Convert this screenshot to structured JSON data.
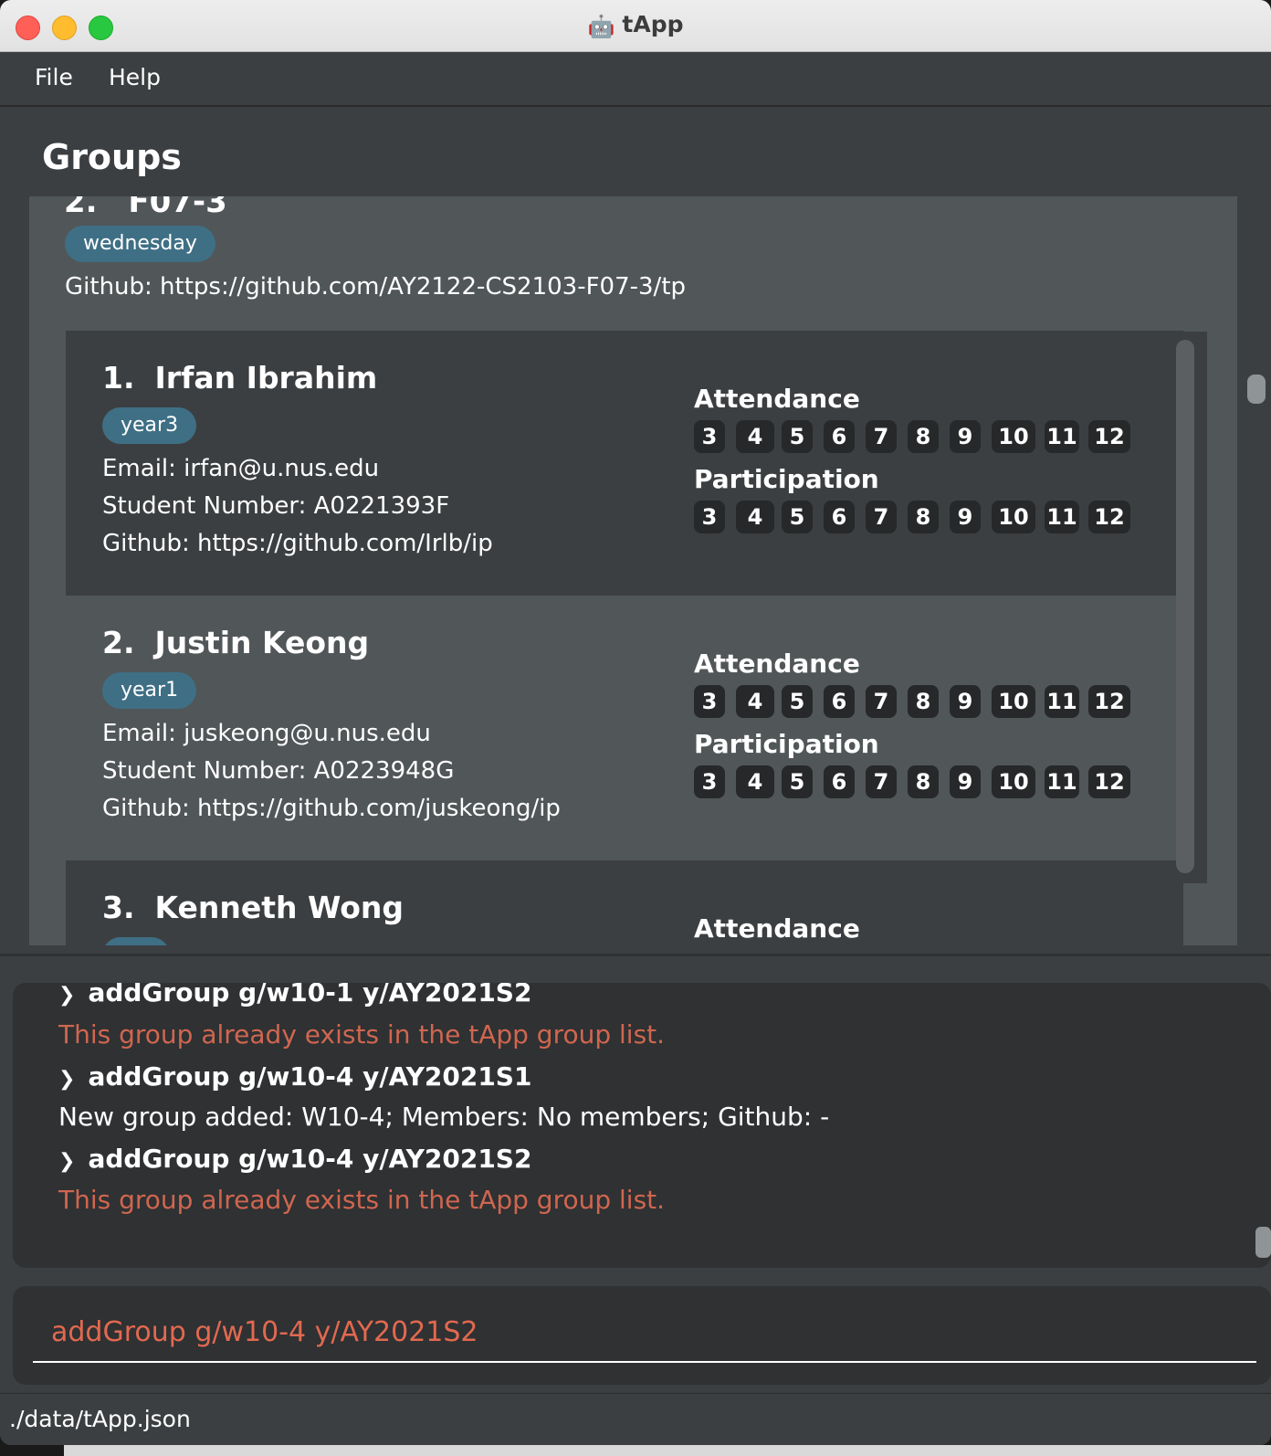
{
  "window": {
    "title": "tApp",
    "app_icon": "robot-icon"
  },
  "menu": [
    "File",
    "Help"
  ],
  "panel_title": "Groups",
  "group": {
    "index": "2.",
    "name": "F07-3",
    "tag": "wednesday",
    "github": "Github: https://github.com/AY2122-CS2103-F07-3/tp"
  },
  "labels": {
    "attendance": "Attendance",
    "participation": "Participation"
  },
  "weeks": [
    "3",
    "4",
    "5",
    "6",
    "7",
    "8",
    "9",
    "10",
    "11",
    "12"
  ],
  "students": [
    {
      "index": "1.",
      "name": "Irfan Ibrahim",
      "tag": "year3",
      "email": "Email: irfan@u.nus.edu",
      "student_number": "Student Number: A0221393F",
      "github": "Github: https://github.com/Irlb/ip"
    },
    {
      "index": "2.",
      "name": "Justin Keong",
      "tag": "year1",
      "email": "Email: juskeong@u.nus.edu",
      "student_number": "Student Number: A0223948G",
      "github": "Github: https://github.com/juskeong/ip"
    },
    {
      "index": "3.",
      "name": "Kenneth Wong"
    }
  ],
  "results": [
    {
      "type": "command",
      "text": "addGroup g/w10-1 y/AY2021S2"
    },
    {
      "type": "error",
      "text": "This group already exists in the tApp group list."
    },
    {
      "type": "command",
      "text": "addGroup g/w10-4 y/AY2021S1"
    },
    {
      "type": "success",
      "text": "New group added: W10-4; Members: No members; Github: -"
    },
    {
      "type": "command",
      "text": "addGroup g/w10-4 y/AY2021S2"
    },
    {
      "type": "error",
      "text": "This group already exists in the tApp group list."
    }
  ],
  "command_input": {
    "value": "addGroup g/w10-4 y/AY2021S2"
  },
  "status_bar": {
    "path": "./data/tApp.json"
  },
  "colors": {
    "tag_bg": "#3f6f85",
    "error_text": "#d0664f",
    "panel_bg": "#515658",
    "card_dark": "#3c3f41",
    "week_badge": "#262829"
  }
}
